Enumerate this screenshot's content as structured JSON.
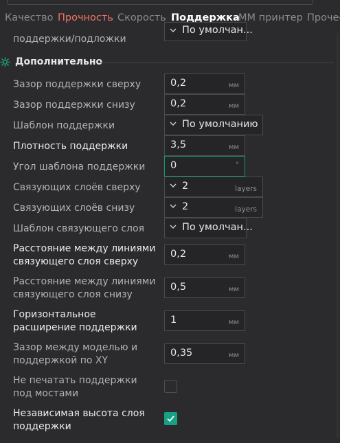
{
  "tabs": [
    "Качество",
    "Прочность",
    "Скорость",
    "Поддержка",
    "MM принтер",
    "Прочее"
  ],
  "top_row": {
    "label": "поддержки/подложки",
    "value": "По умолчан..."
  },
  "section": {
    "title": "Дополнительно"
  },
  "rows": [
    {
      "label": "Зазор поддержки сверху",
      "value": "0,2",
      "unit": "мм"
    },
    {
      "label": "Зазор поддержки снизу",
      "value": "0,2",
      "unit": "мм"
    },
    {
      "label": "Шаблон поддержки",
      "value": "По умолчанию"
    },
    {
      "label": "Плотность поддержки",
      "value": "3,5",
      "unit": "мм"
    },
    {
      "label": "Угол шаблона поддержки",
      "value": "0",
      "unit": "°"
    },
    {
      "label": "Связующих слоёв сверху",
      "value": "2",
      "unit": "layers"
    },
    {
      "label": "Связующих слоёв снизу",
      "value": "2",
      "unit": "layers"
    },
    {
      "label": "Шаблон связующего слоя",
      "value": "По умолчан..."
    },
    {
      "label_line1": "Расстояние между линиями",
      "label_line2": "связующего слоя сверху",
      "value": "0,2",
      "unit": "мм"
    },
    {
      "label_line1": "Расстояние между линиями",
      "label_line2": "связующего слоя снизу",
      "value": "0,5",
      "unit": "мм"
    },
    {
      "label_line1": "Горизонтальное",
      "label_line2": "расширение поддержки",
      "value": "1",
      "unit": "мм"
    },
    {
      "label_line1": "Зазор между моделью и",
      "label_line2": "поддержкой по XY",
      "value": "0,35",
      "unit": "мм"
    },
    {
      "label_line1": "Не печатать поддержки",
      "label_line2": "под мостами",
      "checked": false
    },
    {
      "label_line1": "Независимая высота слоя",
      "label_line2": "поддержки",
      "checked": true
    }
  ],
  "colors": {
    "accent": "#16a085",
    "tab_red": "#f27466",
    "background": "#2b2b2d"
  },
  "icons": {
    "section": "gear-icon",
    "combo": "chevron-down-icon",
    "check": "checkmark-icon"
  }
}
